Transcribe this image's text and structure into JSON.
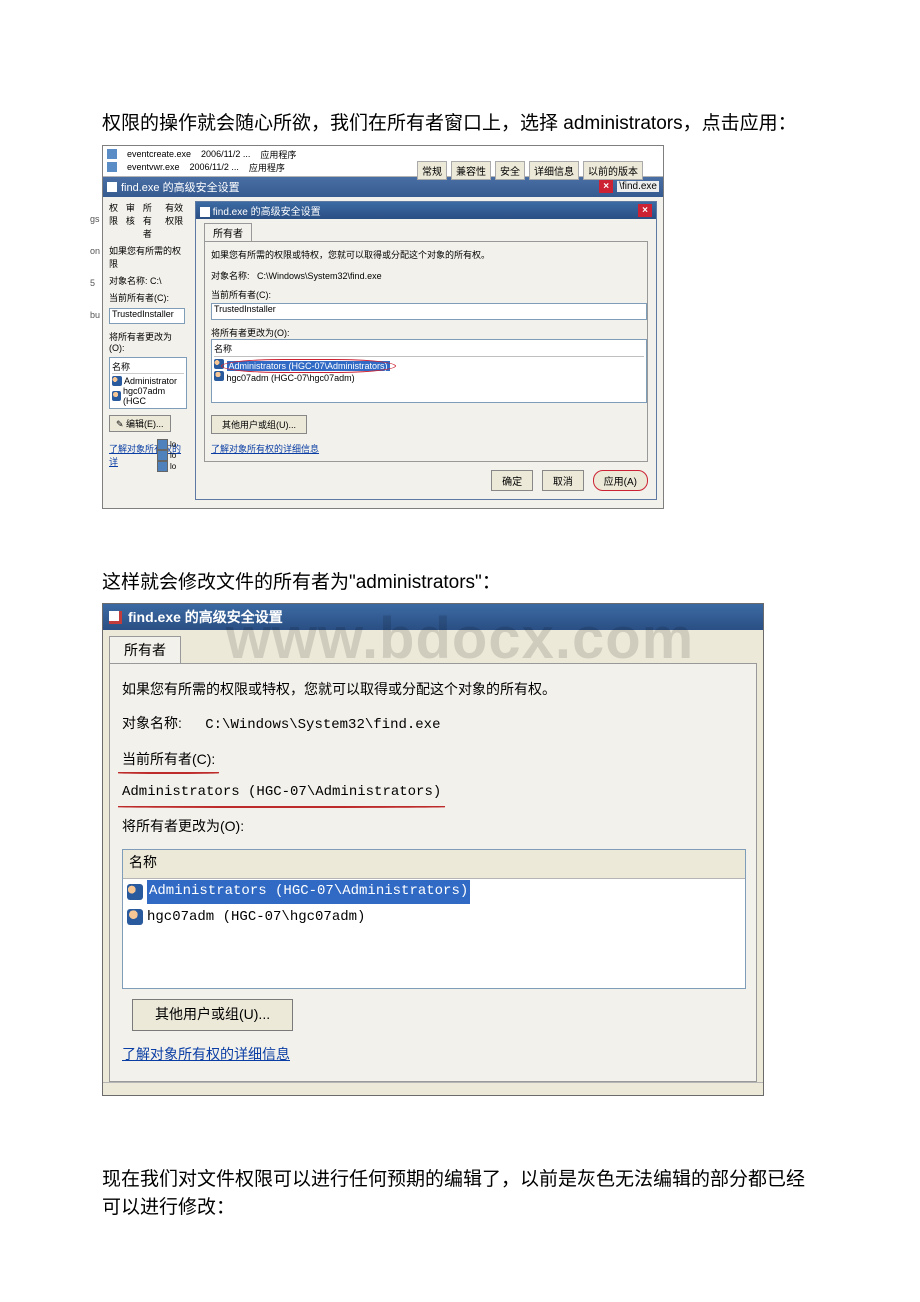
{
  "watermark": "www.bdocx.com",
  "para1": "权限的操作就会随心所欲，我们在所有者窗口上，选择 administrators，点击应用：",
  "para2": "这样就会修改文件的所有者为\"administrators\"：",
  "para3": "现在我们对文件权限可以进行任何预期的编辑了，以前是灰色无法编辑的部分都已经可以进行修改：",
  "gutter": [
    "gs",
    "on",
    "5",
    "bu"
  ],
  "propTabs": [
    "常规",
    "兼容性",
    "安全",
    "详细信息",
    "以前的版本"
  ],
  "shot1": {
    "files": [
      {
        "name": "eventcreate.exe",
        "date": "2006/11/2 ...",
        "type": "应用程序"
      },
      {
        "name": "eventvwr.exe",
        "date": "2006/11/2 ...",
        "type": "应用程序"
      }
    ],
    "addr_title": "find.exe 的高级安全设置",
    "addr_right": "\\find.exe",
    "leftTabs": {
      "t1": "权限",
      "t2": "审核",
      "t3": "所有者",
      "t4": "有效权限"
    },
    "left": {
      "l1": "如果您有所需的权限",
      "obj_lbl": "对象名称:",
      "obj_val": "C:\\",
      "cur_lbl": "当前所有者(C):",
      "cur_val": "TrustedInstaller",
      "chg_lbl": "将所有者更改为(O):",
      "list_hdr": "名称",
      "li1": "Administrator",
      "li2": "hgc07adm (HGC",
      "edit_btn": "编辑(E)...",
      "link": "了解对象所有权的详"
    },
    "inner": {
      "title": "find.exe 的高级安全设置",
      "tab": "所有者",
      "note": "如果您有所需的权限或特权，您就可以取得或分配这个对象的所有权。",
      "obj_lbl": "对象名称:",
      "obj_val": "C:\\Windows\\System32\\find.exe",
      "cur_lbl": "当前所有者(C):",
      "cur_val": "TrustedInstaller",
      "chg_lbl": "将所有者更改为(O):",
      "hdr": "名称",
      "row1": "Administrators (HGC-07\\Administrators)",
      "row2": "hgc07adm (HGC-07\\hgc07adm)",
      "other_btn": "其他用户或组(U)...",
      "link": "了解对象所有权的详细信息",
      "ok": "确定",
      "cancel": "取消",
      "apply": "应用(A)"
    },
    "iconsbl": [
      "lo",
      "lo",
      "lo"
    ]
  },
  "shot2": {
    "title": "find.exe 的高级安全设置",
    "tab": "所有者",
    "note": "如果您有所需的权限或特权，您就可以取得或分配这个对象的所有权。",
    "obj_lbl": "对象名称:",
    "obj_val": "C:\\Windows\\System32\\find.exe",
    "cur_lbl": "当前所有者(C):",
    "cur_val": "Administrators (HGC-07\\Administrators)",
    "chg_lbl": "将所有者更改为(O):",
    "hdr": "名称",
    "row1": "Administrators (HGC-07\\Administrators)",
    "row2": "hgc07adm (HGC-07\\hgc07adm)",
    "other_btn": "其他用户或组(U)...",
    "link": "了解对象所有权的详细信息"
  }
}
